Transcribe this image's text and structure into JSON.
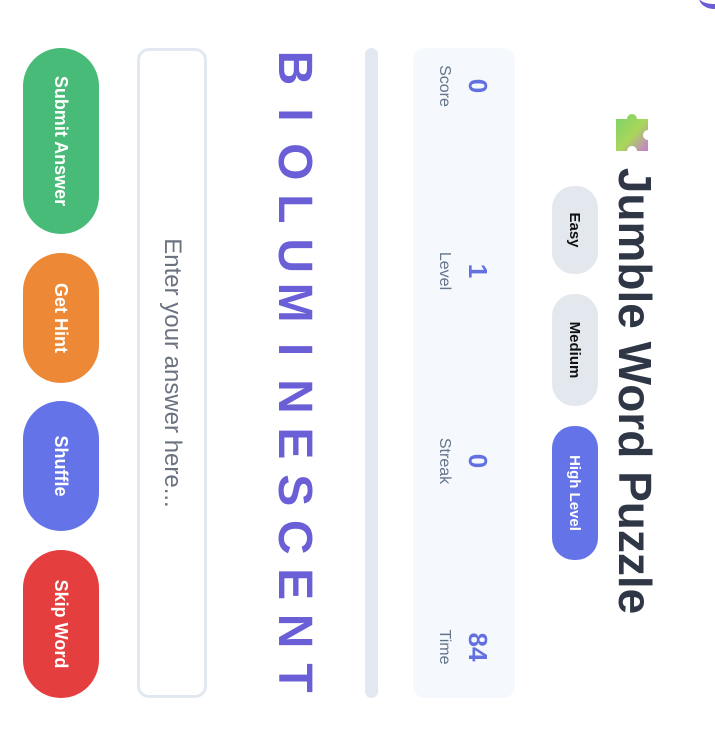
{
  "game": {
    "title": "Jumble Word Puzzle",
    "icon": "puzzle-piece-icon",
    "difficulty": {
      "options": [
        "Easy",
        "Medium",
        "High Level"
      ],
      "selected": "High Level"
    },
    "stats": {
      "score": {
        "label": "Score",
        "value": "0"
      },
      "level": {
        "label": "Level",
        "value": "1"
      },
      "streak": {
        "label": "Streak",
        "value": "0"
      },
      "time": {
        "label": "Time",
        "value": "84"
      }
    },
    "progress_percent": 0,
    "scrambled_letters": [
      "B",
      "I",
      "O",
      "L",
      "U",
      "M",
      "I",
      "N",
      "E",
      "S",
      "C",
      "E",
      "N",
      "T"
    ],
    "answer": {
      "value": "",
      "placeholder": "Enter your answer here..."
    },
    "actions": {
      "submit": "Submit Answer",
      "hint": "Get Hint",
      "shuffle": "Shuffle",
      "skip": "Skip Word"
    }
  },
  "colors": {
    "accent": "#6474e8",
    "letters": "#6a5fd6",
    "submit": "#48bb78",
    "hint": "#ed8936",
    "skip": "#e53e3e",
    "title": "#2f3746"
  }
}
